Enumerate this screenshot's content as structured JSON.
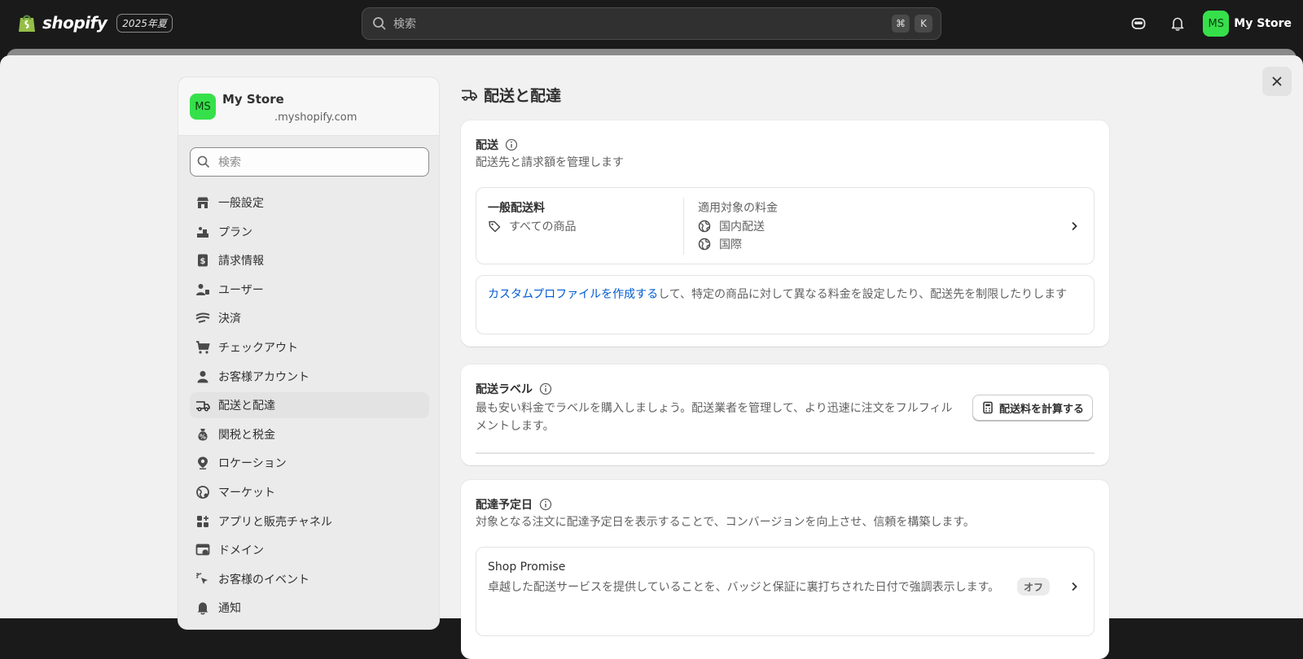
{
  "topbar": {
    "brand": "shopify",
    "edition_badge": "2025年夏",
    "search_placeholder": "検索",
    "shortcut_keys": [
      "⌘",
      "K"
    ],
    "store_name": "My Store",
    "avatar_initials": "MS"
  },
  "sidebar": {
    "avatar_initials": "MS",
    "store_name": "My Store",
    "store_domain": ".myshopify.com",
    "search_placeholder": "検索",
    "items": [
      {
        "label": "一般設定",
        "icon": "store-icon"
      },
      {
        "label": "プラン",
        "icon": "plan-icon"
      },
      {
        "label": "請求情報",
        "icon": "billing-icon"
      },
      {
        "label": "ユーザー",
        "icon": "users-icon"
      },
      {
        "label": "決済",
        "icon": "payments-icon"
      },
      {
        "label": "チェックアウト",
        "icon": "cart-icon"
      },
      {
        "label": "お客様アカウント",
        "icon": "person-icon"
      },
      {
        "label": "配送と配達",
        "icon": "truck-icon",
        "active": true
      },
      {
        "label": "関税と税金",
        "icon": "tax-icon"
      },
      {
        "label": "ロケーション",
        "icon": "location-icon"
      },
      {
        "label": "マーケット",
        "icon": "globe-icon"
      },
      {
        "label": "アプリと販売チャネル",
        "icon": "apps-icon"
      },
      {
        "label": "ドメイン",
        "icon": "domain-icon"
      },
      {
        "label": "お客様のイベント",
        "icon": "cursor-icon"
      },
      {
        "label": "通知",
        "icon": "bell-icon"
      }
    ]
  },
  "main": {
    "title": "配送と配達",
    "shipping": {
      "heading": "配送",
      "description": "配送先と請求額を管理します",
      "profile": {
        "name": "一般配送料",
        "products": "すべての商品",
        "rates_heading": "適用対象の料金",
        "rates": [
          "国内配送",
          "国際"
        ]
      },
      "custom_link": "カスタムプロファイルを作成する",
      "custom_text": "して、特定の商品に対して異なる料金を設定したり、配送先を制限したりします"
    },
    "labels": {
      "heading": "配送ラベル",
      "description": "最も安い料金でラベルを購入しましょう。配送業者を管理して、より迅速に注文をフルフィルメントします。",
      "button": "配送料を計算する"
    },
    "delivery_dates": {
      "heading": "配達予定日",
      "description": "対象となる注文に配達予定日を表示することで、コンバージョンを向上させ、信頼を構築します。",
      "shop_promise": {
        "title": "Shop Promise",
        "description": "卓越した配送サービスを提供していることを、バッジと保証に裏打ちされた日付で強調表示します。",
        "status": "オフ"
      }
    }
  },
  "colors": {
    "topbar_bg": "#1a1a1a",
    "avatar_green": "#36e04a",
    "link_blue": "#005bd3",
    "page_bg": "#f1f1f1"
  }
}
